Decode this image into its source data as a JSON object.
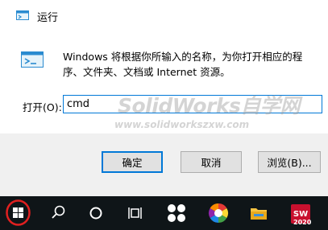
{
  "dialog": {
    "title": "运行",
    "description": "Windows 将根据你所输入的名称，为你打开相应的程序、文件夹、文档或 Internet 资源。",
    "open_label": "打开(O):",
    "input_value": "cmd",
    "buttons": {
      "ok": "确定",
      "cancel": "取消",
      "browse": "浏览(B)..."
    }
  },
  "watermark": {
    "text": "SolidWorks自学网",
    "url": "www.solidworkszxw.com"
  },
  "taskbar": {
    "items": [
      {
        "name": "start-button",
        "icon": "windows-logo-icon"
      },
      {
        "name": "search-button",
        "icon": "search-icon"
      },
      {
        "name": "cortana-button",
        "icon": "cortana-circle-icon"
      },
      {
        "name": "task-view-button",
        "icon": "task-view-icon"
      },
      {
        "name": "app-pinwheel",
        "icon": "pinwheel-icon"
      },
      {
        "name": "app-colorful",
        "icon": "color-ball-icon"
      },
      {
        "name": "file-explorer",
        "icon": "folder-icon"
      },
      {
        "name": "solidworks-2020",
        "icon": "solidworks-icon",
        "badge": "2020"
      }
    ],
    "accent_colors": {
      "start_highlight": "#e02020",
      "folder": "#f5c342",
      "solidworks": "#c8102e"
    }
  }
}
